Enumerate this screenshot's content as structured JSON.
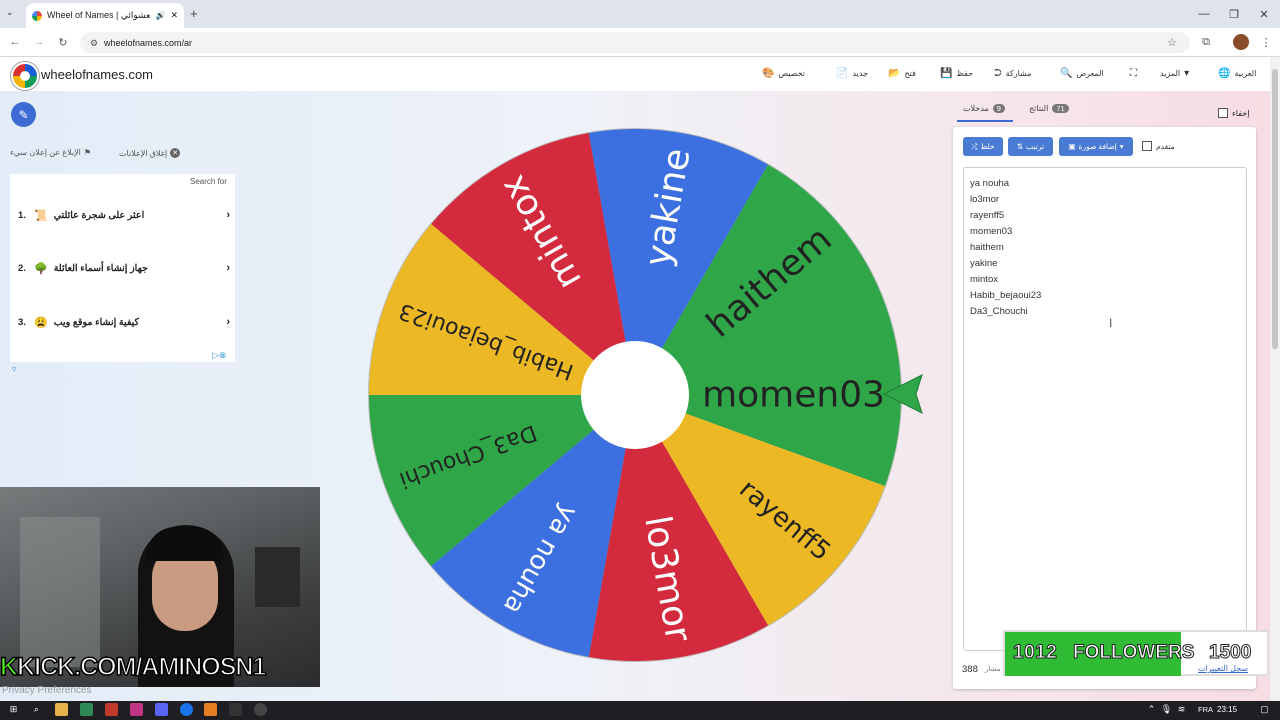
{
  "browser": {
    "tab_title": "Wheel of Names | العشوائي",
    "url": "wheelofnames.com/ar",
    "window_controls": [
      "minimize-icon",
      "restore-icon",
      "close-icon"
    ]
  },
  "header": {
    "brand": "wheelofnames.com",
    "menu": [
      {
        "label": "العربية",
        "icon": "globe-icon"
      },
      {
        "label": "المزيد",
        "icon": "chevron-down-icon"
      },
      {
        "label": "",
        "icon": "fullscreen-icon"
      },
      {
        "label": "المعرض",
        "icon": "search-icon"
      },
      {
        "label": "مشاركة",
        "icon": "share-icon"
      },
      {
        "label": "حفظ",
        "icon": "save-icon"
      },
      {
        "label": "فتح",
        "icon": "folder-icon"
      },
      {
        "label": "جديد",
        "icon": "file-icon"
      },
      {
        "label": "تخصيص",
        "icon": "palette-icon"
      }
    ]
  },
  "ad": {
    "report_label": "الإبلاغ عن إعلان سيء",
    "close_label": "إغلاق الإعلانات",
    "search_label": "Search for",
    "items": [
      {
        "num": "1.",
        "emoji": "📜",
        "text": "اعثر على شجرة عائلتي"
      },
      {
        "num": "2.",
        "emoji": "🌳",
        "text": "جهاز إنشاء أسماء العائلة"
      },
      {
        "num": "3.",
        "emoji": "😩",
        "text": "كيفية إنشاء موقع ويب"
      }
    ]
  },
  "wheel": {
    "colors": [
      "#2fa748",
      "#ecb824",
      "#d42a3d",
      "#3c6fe0"
    ],
    "pointer_color": "#2fa748",
    "segments": [
      "momen03",
      "rayenff5",
      "lo3mor",
      "ya nouha",
      "Da3_Chouchi",
      "Habib_bejaoui23",
      "mintox",
      "yakine",
      "haithem"
    ]
  },
  "panel": {
    "tab_entries": "مدخلات",
    "tab_entries_count": "9",
    "tab_results": "النتائج",
    "tab_results_count": "71",
    "hide_label": "إخفاء",
    "shuffle_label": "خلط",
    "sort_label": "ترتيب",
    "add_image_label": "إضافة صورة",
    "advanced_label": "متقدم",
    "entries": [
      "ya nouha",
      "lo3mor",
      "rayenff5",
      "momen03",
      "haithem",
      "yakine",
      "mintox",
      "Habib_bejaoui23",
      "Da3_Chouchi"
    ],
    "spin_count": "388",
    "spin_count_suffix": "مشار"
  },
  "overlay": {
    "followers_current": "1012",
    "followers_label": "FOLLOWERS",
    "followers_goal": "1500",
    "changelog_link": "سجل التغييرات",
    "kick_prefix": "K",
    "kick_text": "KICK.COM/AMINOSN1",
    "privacy": "Privacy Preferences"
  },
  "taskbar": {
    "lang": "FRA",
    "time": "23:15"
  }
}
